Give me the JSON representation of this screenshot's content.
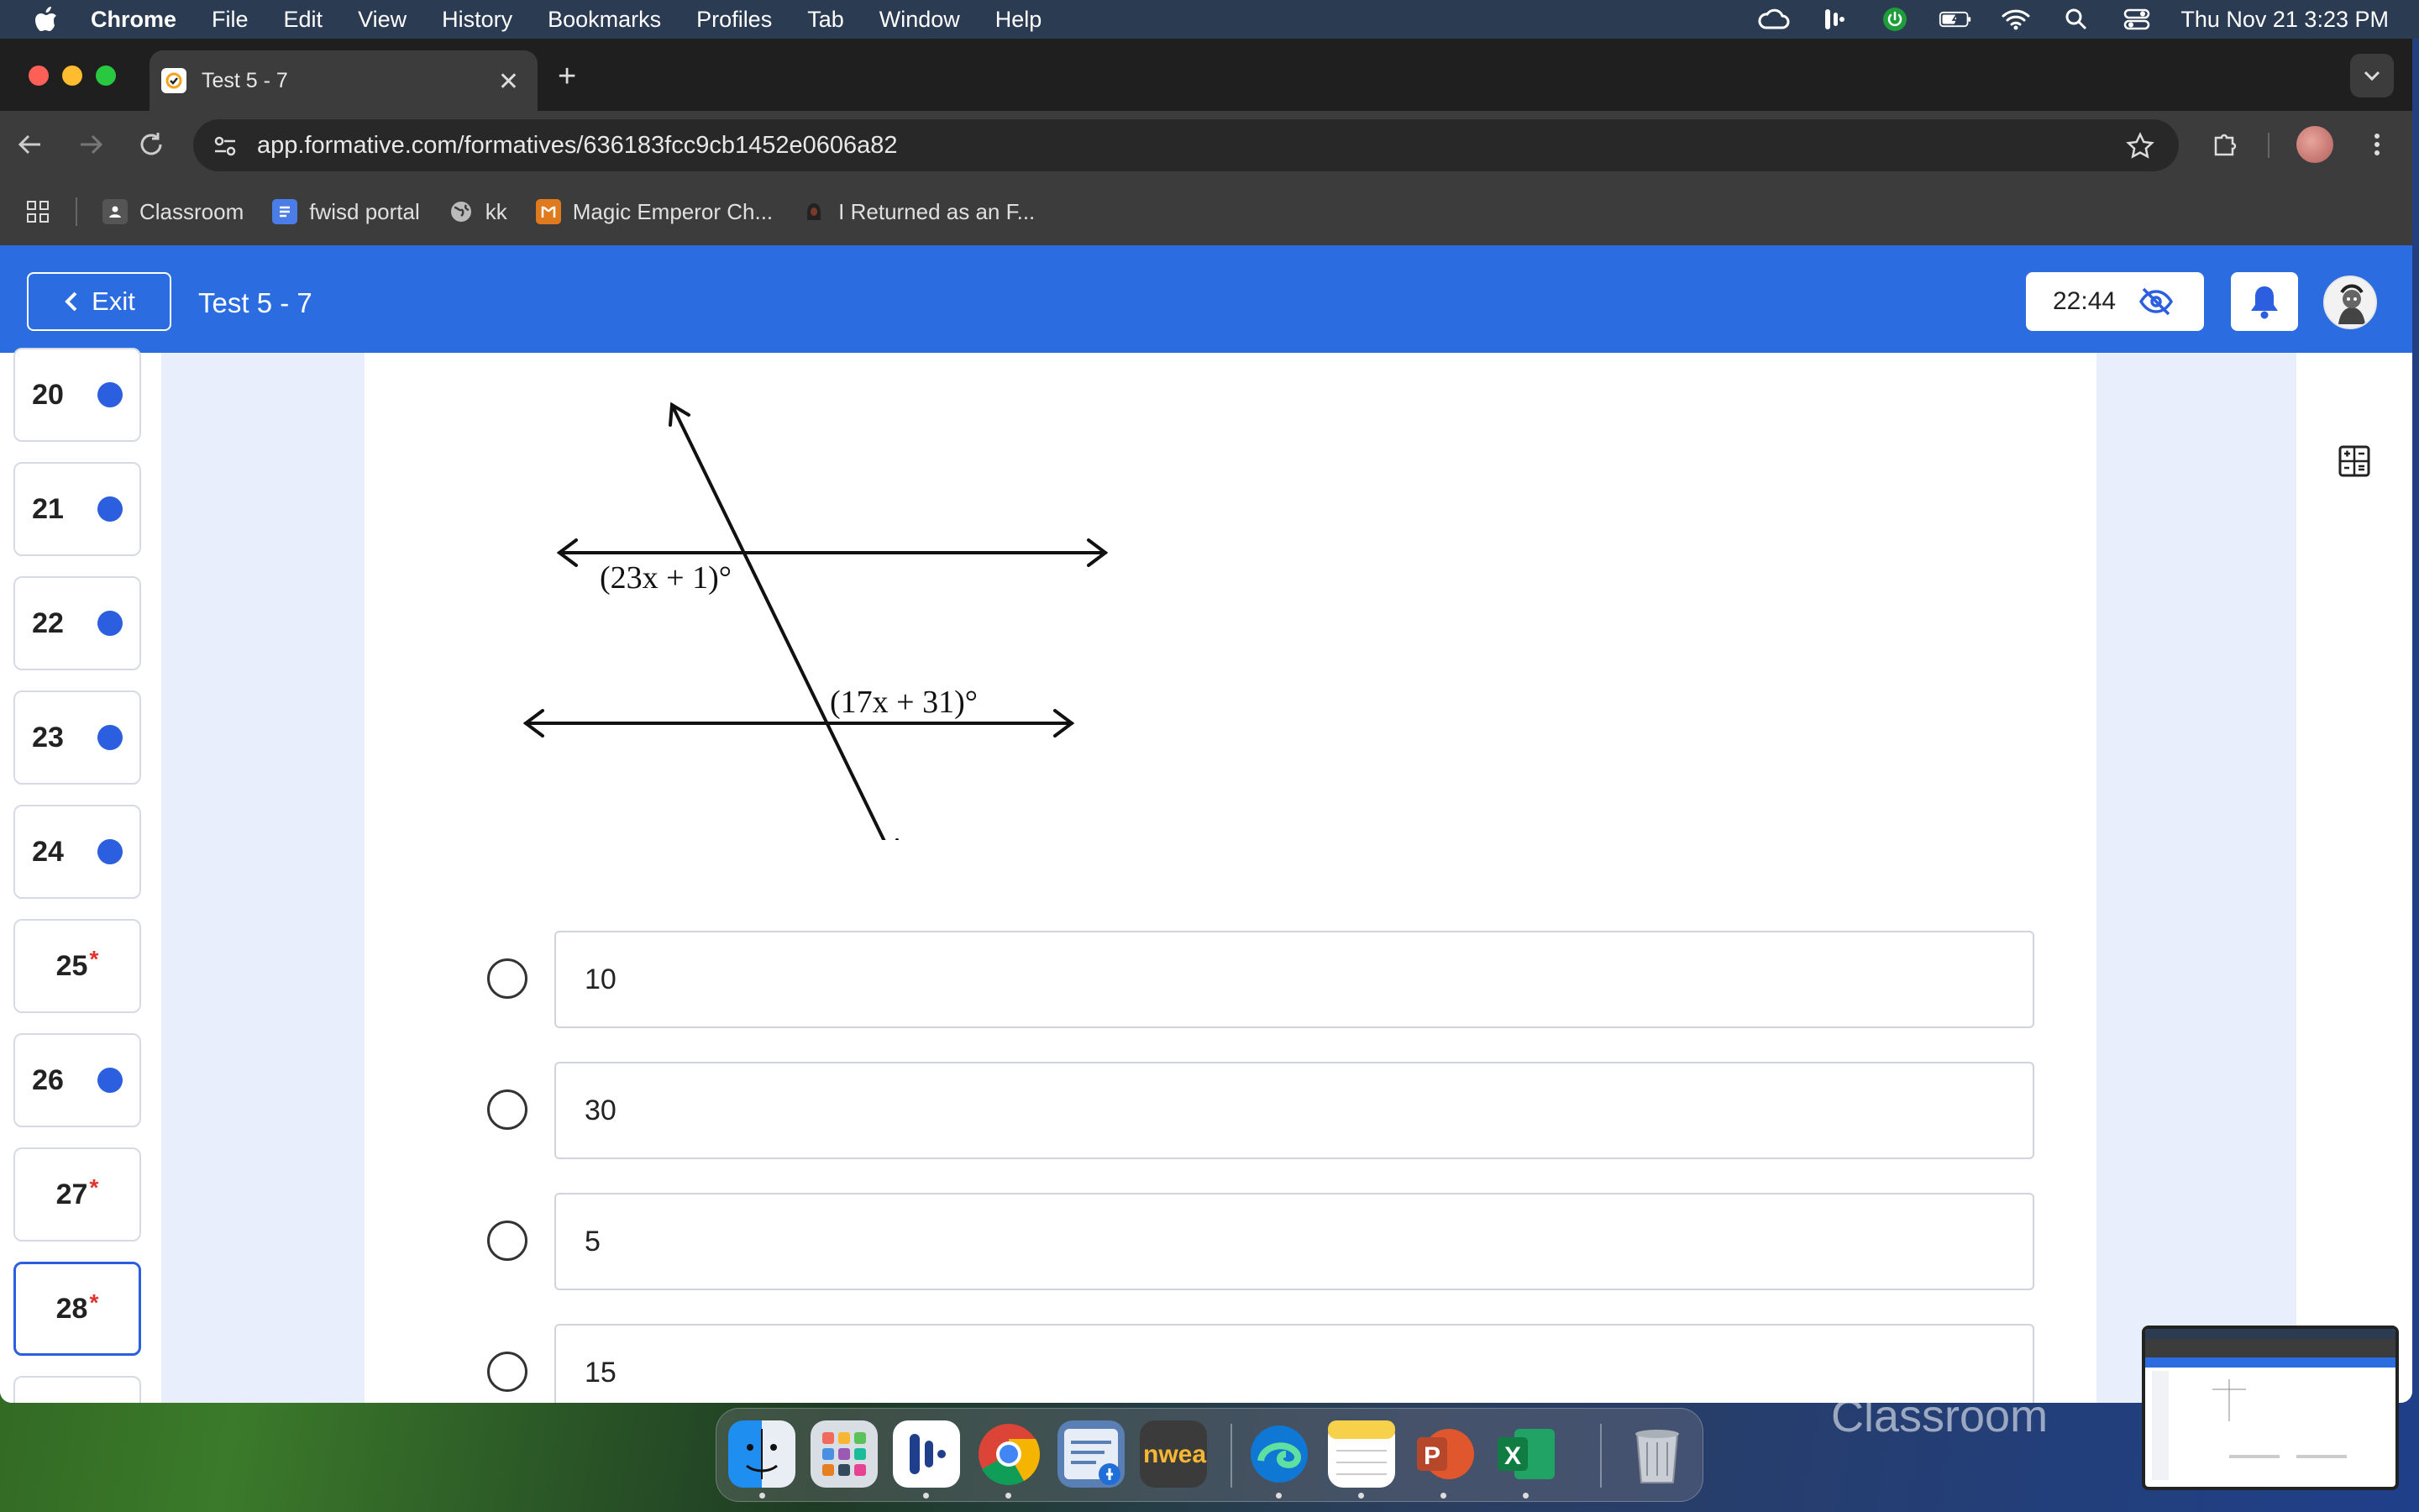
{
  "menubar": {
    "app": "Chrome",
    "items": [
      "File",
      "Edit",
      "View",
      "History",
      "Bookmarks",
      "Profiles",
      "Tab",
      "Window",
      "Help"
    ],
    "datetime": "Thu Nov 21  3:23 PM"
  },
  "browser": {
    "tab_title": "Test 5 - 7",
    "url": "app.formative.com/formatives/636183fcc9cb1452e0606a82",
    "bookmarks": [
      "Classroom",
      "fwisd portal",
      "kk",
      "Magic Emperor Ch...",
      "I Returned as an F..."
    ]
  },
  "app": {
    "exit_label": "Exit",
    "title": "Test 5 - 7",
    "timer": "22:44"
  },
  "questions": [
    {
      "num": "20",
      "status": "answered"
    },
    {
      "num": "21",
      "status": "answered"
    },
    {
      "num": "22",
      "status": "answered"
    },
    {
      "num": "23",
      "status": "answered"
    },
    {
      "num": "24",
      "status": "answered"
    },
    {
      "num": "25",
      "status": "required"
    },
    {
      "num": "26",
      "status": "answered"
    },
    {
      "num": "27",
      "status": "required"
    },
    {
      "num": "28",
      "status": "required",
      "current": true
    }
  ],
  "figure": {
    "angle_top": "(23x + 1)°",
    "angle_bottom": "(17x + 31)°"
  },
  "choices": [
    "10",
    "30",
    "5",
    "15"
  ],
  "desktop": {
    "dock_apps": [
      "Finder",
      "Launchpad",
      "Otter",
      "Chrome",
      "Notes Utility",
      "nwea",
      "Edge",
      "Notes",
      "PowerPoint",
      "Excel",
      "Trash"
    ],
    "nwea_label": "nwea",
    "background_text": "Classroom"
  }
}
